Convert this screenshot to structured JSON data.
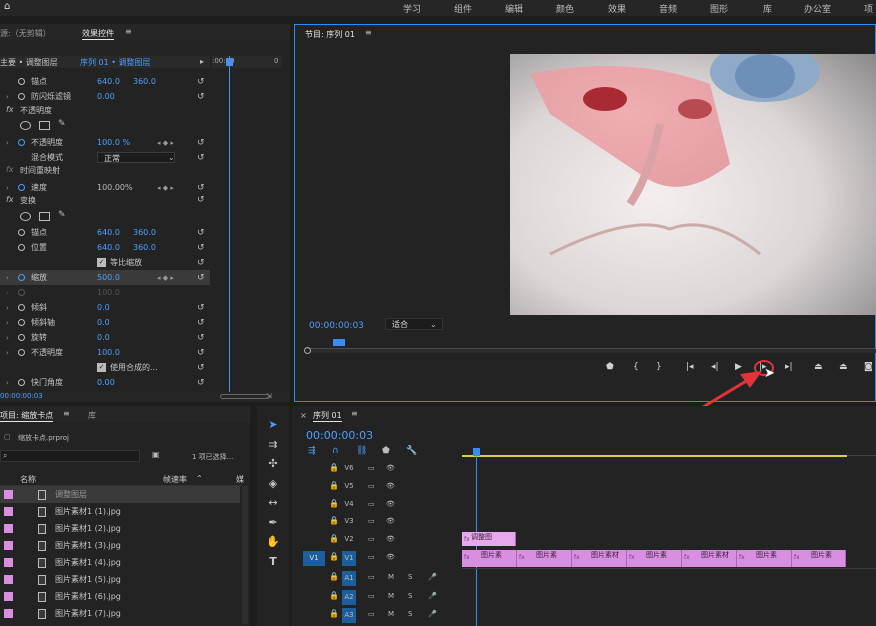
{
  "menubar": {
    "home_icon": "home-icon",
    "items": [
      "学习",
      "组件",
      "编辑",
      "颜色",
      "效果",
      "音频",
      "图形",
      "库",
      "办公室",
      "项"
    ]
  },
  "left_top": {
    "tab_source": "源:（无剪辑）",
    "tab_effects": "效果控件",
    "menu_icon": "≡",
    "master_label": "主要 • 调整图层",
    "clip_label": "序列 01 • 调整图层",
    "ruler_start": ":00:00",
    "ruler_end": "0"
  },
  "effect_rows": [
    {
      "label": "锚点",
      "v1": "640.0",
      "v2": "360.0"
    },
    {
      "label": "防闪烁滤镜",
      "v1": "0.00"
    },
    {
      "section": "不透明度"
    },
    {
      "label": "不透明度",
      "v1": "100.0 %"
    },
    {
      "label": "混合模式",
      "v1": "正常"
    },
    {
      "section": "时间重映射"
    },
    {
      "label": "速度",
      "v1": "100.00%"
    },
    {
      "section": "变换"
    },
    {
      "label": "锚点",
      "v1": "640.0",
      "v2": "360.0"
    },
    {
      "label": "位置",
      "v1": "640.0",
      "v2": "360.0"
    },
    {
      "label": "等比缩放"
    },
    {
      "label": "缩放",
      "v1": "500.0"
    },
    {
      "v1": "100.0"
    },
    {
      "label": "倾斜",
      "v1": "0.0"
    },
    {
      "label": "倾斜轴",
      "v1": "0.0"
    },
    {
      "label": "旋转",
      "v1": "0.0"
    },
    {
      "label": "不透明度",
      "v1": "100.0"
    },
    {
      "label": "使用合成的..."
    },
    {
      "label": "快门角度",
      "v1": "0.00"
    }
  ],
  "ec_timecode": "00:00:00:03",
  "program": {
    "title": "节目: 序列 01",
    "menu_icon": "≡",
    "timecode": "00:00:00:03",
    "fit": "适合",
    "buttons": [
      "marker-icon",
      "in-point-icon",
      "out-point-icon",
      "go-to-in-icon",
      "step-back-icon",
      "play-icon",
      "step-forward-icon",
      "go-to-out-icon",
      "lift-icon",
      "extract-icon",
      "export-frame-icon"
    ]
  },
  "project": {
    "tab": "项目: 缩放卡点",
    "menu_icon": "≡",
    "tab2": "库",
    "file": "缩放卡点.prproj",
    "selection": "1 项已选择...",
    "col_name": "名称",
    "col_rate": "帧速率",
    "col_media": "媒",
    "items": [
      "调整图层",
      "图片素材1 (1).jpg",
      "图片素材1 (2).jpg",
      "图片素材1 (3).jpg",
      "图片素材1 (4).jpg",
      "图片素材1 (5).jpg",
      "图片素材1 (6).jpg",
      "图片素材1 (7).jpg"
    ]
  },
  "timeline": {
    "tab": "序列 01",
    "menu_icon": "≡",
    "timecode": "00:00:00:03",
    "tracks": [
      "V6",
      "V5",
      "V4",
      "V3",
      "V2",
      "V1",
      "A1",
      "A2",
      "A3"
    ],
    "v1_src": "V1",
    "adj_clip": "调整图",
    "clips": [
      "图片素",
      "图片素",
      "图片素材",
      "图片素",
      "图片素材",
      "图片素",
      "图片素"
    ]
  },
  "colors": {
    "accent": "#4aa0ff",
    "clip": "#d88fe0",
    "highlight": "#e0343a"
  }
}
